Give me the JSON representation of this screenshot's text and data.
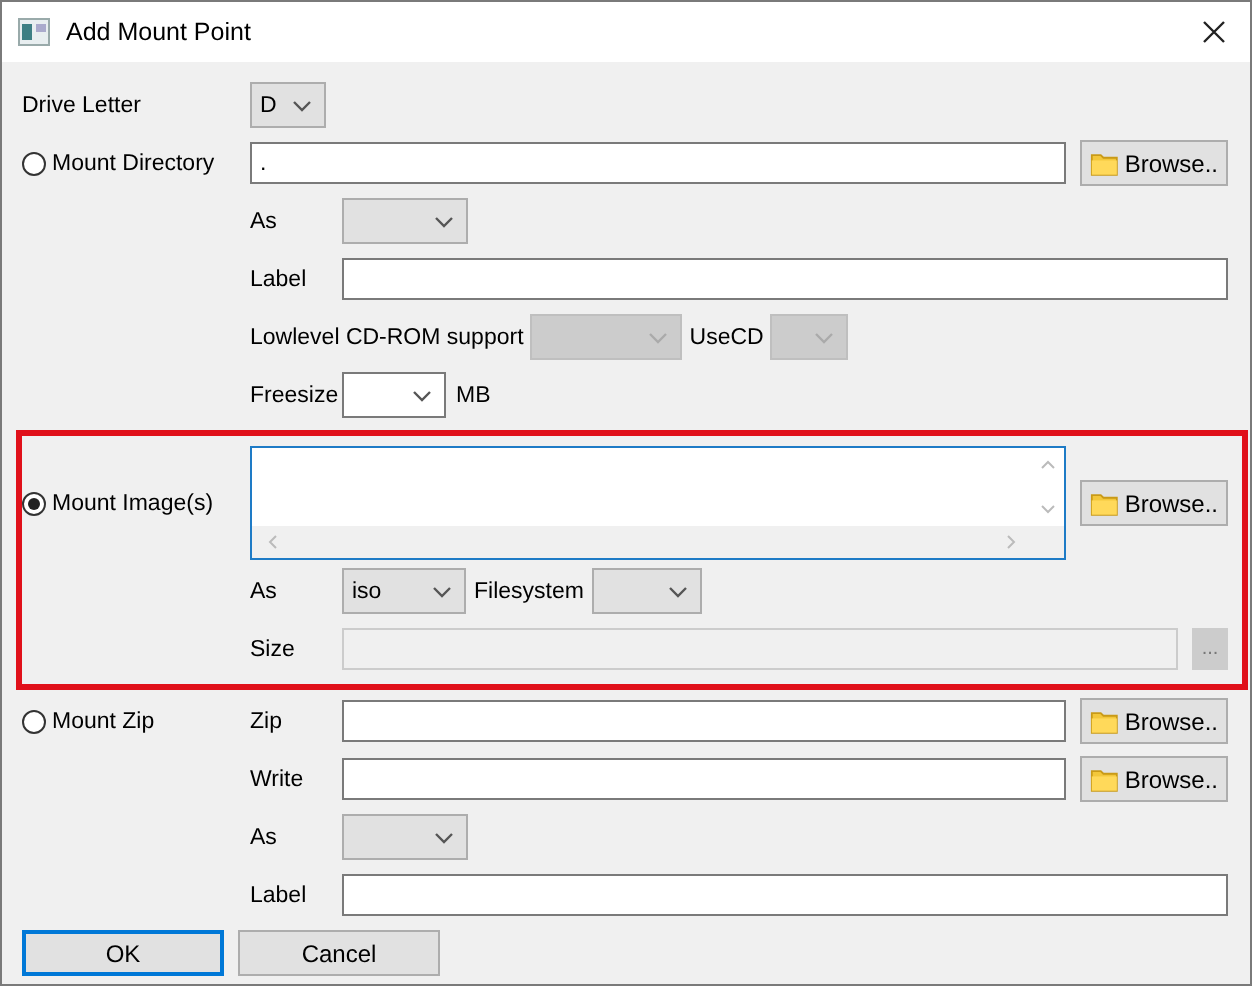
{
  "window": {
    "title": "Add Mount Point"
  },
  "drive_letter": {
    "label": "Drive Letter",
    "value": "D",
    "kind": "list",
    "disabled": false
  },
  "mount_directory": {
    "label": "Mount Directory",
    "selected": false,
    "path": ".",
    "browse": "Browse..",
    "as": {
      "label": "As",
      "kind": "list",
      "disabled": false
    },
    "label_field": {
      "label": "Label"
    },
    "lowlevel": {
      "label": "Lowlevel CD-ROM support",
      "kind": "list",
      "disabled": true
    },
    "usecd": {
      "label": "UseCD",
      "kind": "list",
      "disabled": true
    },
    "freesize": {
      "label": "Freesize",
      "unit": "MB",
      "kind": "editable",
      "disabled": false
    }
  },
  "mount_image": {
    "label": "Mount Image(s)",
    "selected": true,
    "highlighted": true,
    "browse": "Browse..",
    "as": {
      "label": "As",
      "value": "iso",
      "kind": "list",
      "disabled": false
    },
    "filesystem": {
      "label": "Filesystem",
      "kind": "list",
      "disabled": false
    },
    "size": {
      "label": "Size",
      "disabled": true,
      "button": "..."
    }
  },
  "mount_zip": {
    "label": "Mount Zip",
    "selected": false,
    "zip": {
      "label": "Zip",
      "browse": "Browse.."
    },
    "write": {
      "label": "Write",
      "browse": "Browse.."
    },
    "as": {
      "label": "As",
      "kind": "list",
      "disabled": false
    },
    "label_field": {
      "label": "Label"
    }
  },
  "buttons": [
    {
      "label": "OK",
      "default": true
    },
    {
      "label": "Cancel",
      "default": false
    }
  ]
}
